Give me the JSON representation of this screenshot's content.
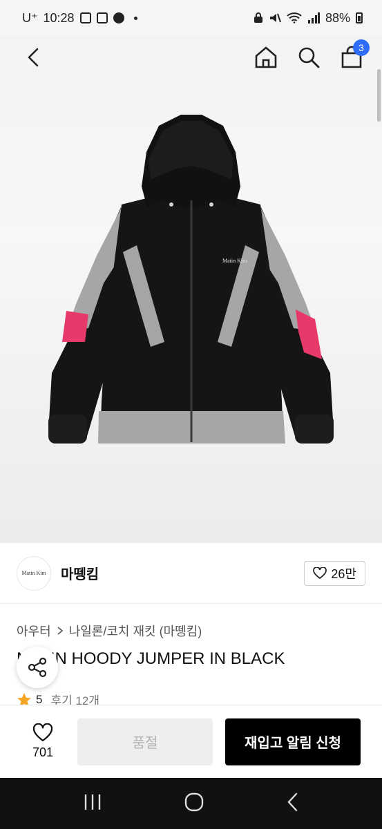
{
  "status_bar": {
    "carrier": "U⁺",
    "time": "10:28",
    "battery": "88%"
  },
  "nav": {
    "cart_count": "3"
  },
  "brand": {
    "logo_text": "Matin Kim",
    "name": "마뗑킴",
    "likes": "26만"
  },
  "breadcrumb": {
    "category": "아우터",
    "subcategory": "나일론/코치 재킷 (마뗑킴)"
  },
  "product": {
    "title": "MATIN HOODY JUMPER IN BLACK",
    "jacket_label": "Matin Kim"
  },
  "rating": {
    "score": "5",
    "reviews": "후기 12개"
  },
  "bottom_bar": {
    "wish_count": "701",
    "soldout_label": "품절",
    "restock_label": "재입고 알림 신청"
  },
  "colors": {
    "accent_badge": "#2f6df6",
    "jacket_black": "#151515",
    "reflective_gray": "#a6a6a6",
    "pink_panel": "#e8396b"
  }
}
